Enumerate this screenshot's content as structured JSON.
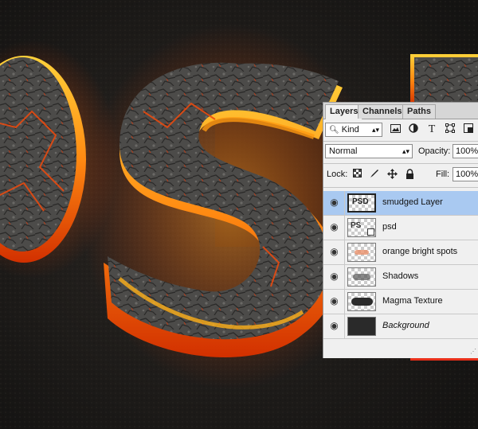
{
  "panel": {
    "tabs": [
      "Layers",
      "Channels",
      "Paths"
    ],
    "filter": {
      "kind_label": "Kind",
      "icons": [
        "image-filter-icon",
        "adjustment-filter-icon",
        "type-filter-icon",
        "shape-filter-icon",
        "smart-object-filter-icon"
      ]
    },
    "blend_mode": "Normal",
    "opacity_label": "Opacity:",
    "opacity_value": "100%",
    "lock_label": "Lock:",
    "lock_icons": [
      "lock-transparency-icon",
      "lock-image-pixels-icon",
      "lock-position-icon",
      "lock-all-icon"
    ],
    "fill_label": "Fill:",
    "fill_value": "100%"
  },
  "layers": [
    {
      "name": "smudged Layer",
      "selected": true,
      "thumb": "psd-text-thumb",
      "thumb_text": "PSD"
    },
    {
      "name": "psd",
      "selected": false,
      "thumb": "smart-object-thumb",
      "thumb_text": "PS"
    },
    {
      "name": "orange bright spots",
      "selected": false,
      "thumb": "orange-spots-thumb"
    },
    {
      "name": "Shadows",
      "selected": false,
      "thumb": "shadows-thumb"
    },
    {
      "name": "Magma Texture",
      "selected": false,
      "thumb": "magma-thumb"
    },
    {
      "name": "Background",
      "selected": false,
      "thumb": "background-thumb",
      "italic": true
    }
  ],
  "colors": {
    "selection": "#a9c9f1",
    "lava": "#ff7a10",
    "rock": "#4a4a4a"
  }
}
